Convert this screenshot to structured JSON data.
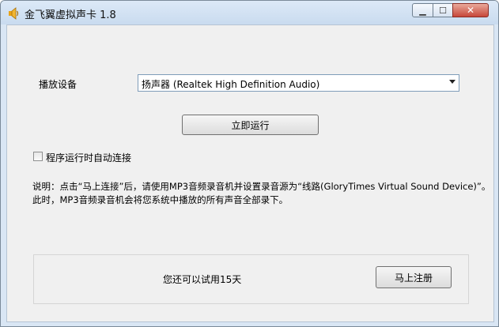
{
  "window": {
    "title": "金飞翼虚拟声卡 1.8",
    "icon": "speaker-icon",
    "controls": {
      "minimize_icon": "minimize-icon",
      "maximize_icon": "maximize-icon",
      "close_icon": "close-icon"
    }
  },
  "form": {
    "device_label": "播放设备",
    "device_value": "扬声器 (Realtek High Definition Audio)",
    "run_button": "立即运行",
    "autoconnect_label": "程序运行时自动连接",
    "autoconnect_checked": false
  },
  "description": {
    "line1": "说明：点击“马上连接”后，请使用MP3音频录音机并设置录音源为“线路(GloryTimes Virtual Sound Device)”。",
    "line2": "此时，MP3音频录音机会将您系统中播放的所有声音全部录下。"
  },
  "trial": {
    "text": "您还可以试用15天",
    "register_button": "马上注册"
  },
  "colors": {
    "accent_close": "#c7473a",
    "title_bg": "#c9dbef",
    "client_bg": "#f0f0f0"
  }
}
